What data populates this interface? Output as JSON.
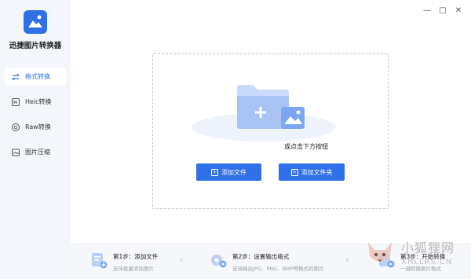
{
  "app": {
    "name": "迅捷图片转换器"
  },
  "sidebar": {
    "items": [
      {
        "label": "格式转换",
        "icon": "convert-icon"
      },
      {
        "label": "Heic转换",
        "icon": "heic-icon"
      },
      {
        "label": "Raw转换",
        "icon": "raw-icon"
      },
      {
        "label": "图片压缩",
        "icon": "compress-icon"
      }
    ]
  },
  "window": {
    "minimize": "—",
    "restore": "□",
    "close": "✕"
  },
  "main": {
    "hint": "或点击下方按钮",
    "add_file_label": "添加文件",
    "add_folder_label": "添加文件夹"
  },
  "steps": [
    {
      "title": "第1步：添加文件",
      "desc": "支持批量添加图片"
    },
    {
      "title": "第2步：设置输出格式",
      "desc": "支持输出JPG、PNG、BMP等格式的图片"
    },
    {
      "title": "第3步：开始转换",
      "desc": "一键转换图片格式"
    }
  ],
  "watermark": {
    "line1": "小狐狸网",
    "line2": "XHLLRS.CN"
  },
  "colors": {
    "accent": "#2f6fe8",
    "sidebar_bg": "#f3f6fb",
    "steps_bg": "#f5f7fa"
  }
}
